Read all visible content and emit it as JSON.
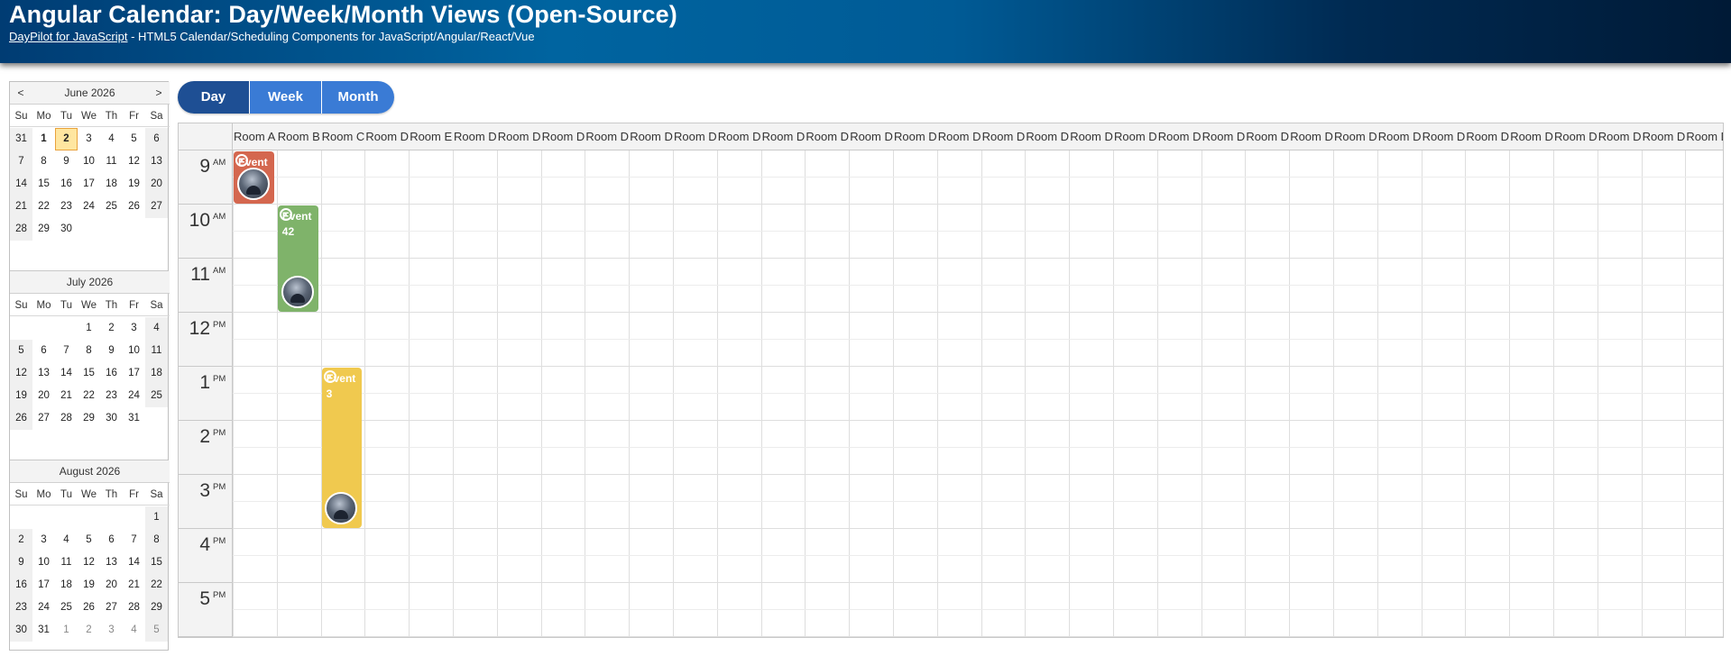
{
  "header": {
    "title": "Angular Calendar: Day/Week/Month Views (Open-Source)",
    "link": "DayPilot for JavaScript",
    "subtitle_rest": " - HTML5 Calendar/Scheduling Components for JavaScript/Angular/React/Vue"
  },
  "navigator": {
    "prev": "<",
    "next": ">",
    "dow": [
      "Su",
      "Mo",
      "Tu",
      "We",
      "Th",
      "Fr",
      "Sa"
    ],
    "months": [
      {
        "title": "June 2026",
        "weeks": [
          [
            "31",
            "1",
            "2",
            "3",
            "4",
            "5",
            "6"
          ],
          [
            "7",
            "8",
            "9",
            "10",
            "11",
            "12",
            "13"
          ],
          [
            "14",
            "15",
            "16",
            "17",
            "18",
            "19",
            "20"
          ],
          [
            "21",
            "22",
            "23",
            "24",
            "25",
            "26",
            "27"
          ],
          [
            "28",
            "29",
            "30",
            "",
            "",
            "",
            ""
          ]
        ]
      },
      {
        "title": "July 2026",
        "weeks": [
          [
            "",
            "",
            "",
            "1",
            "2",
            "3",
            "4"
          ],
          [
            "5",
            "6",
            "7",
            "8",
            "9",
            "10",
            "11"
          ],
          [
            "12",
            "13",
            "14",
            "15",
            "16",
            "17",
            "18"
          ],
          [
            "19",
            "20",
            "21",
            "22",
            "23",
            "24",
            "25"
          ],
          [
            "26",
            "27",
            "28",
            "29",
            "30",
            "31",
            ""
          ]
        ]
      },
      {
        "title": "August 2026",
        "weeks": [
          [
            "",
            "",
            "",
            "",
            "",
            "",
            "1"
          ],
          [
            "2",
            "3",
            "4",
            "5",
            "6",
            "7",
            "8"
          ],
          [
            "9",
            "10",
            "11",
            "12",
            "13",
            "14",
            "15"
          ],
          [
            "16",
            "17",
            "18",
            "19",
            "20",
            "21",
            "22"
          ],
          [
            "23",
            "24",
            "25",
            "26",
            "27",
            "28",
            "29"
          ],
          [
            "30",
            "31",
            "1",
            "2",
            "3",
            "4",
            "5"
          ]
        ]
      }
    ]
  },
  "views": {
    "day": "Day",
    "week": "Week",
    "month": "Month",
    "active": "day"
  },
  "calendar": {
    "columns": [
      "Room A",
      "Room B",
      "Room C",
      "Room D",
      "Room E",
      "Room D",
      "Room D",
      "Room D",
      "Room D",
      "Room D",
      "Room D",
      "Room D",
      "Room D",
      "Room D",
      "Room D",
      "Room D",
      "Room D",
      "Room D",
      "Room D",
      "Room D",
      "Room D",
      "Room D",
      "Room D",
      "Room D",
      "Room D",
      "Room D",
      "Room D",
      "Room D",
      "Room D",
      "Room D",
      "Room D",
      "Room D",
      "Room D",
      "Room D"
    ],
    "hours": [
      {
        "num": "9",
        "ampm": "AM"
      },
      {
        "num": "10",
        "ampm": "AM"
      },
      {
        "num": "11",
        "ampm": "AM"
      },
      {
        "num": "12",
        "ampm": "PM"
      },
      {
        "num": "1",
        "ampm": "PM"
      },
      {
        "num": "2",
        "ampm": "PM"
      },
      {
        "num": "3",
        "ampm": "PM"
      },
      {
        "num": "4",
        "ampm": "PM"
      },
      {
        "num": "5",
        "ampm": "PM"
      }
    ],
    "events": [
      {
        "text": "Event",
        "column": "Room A",
        "color": "#d4674f"
      },
      {
        "text": "Event 42",
        "column": "Room B",
        "color": "#7fb36a"
      },
      {
        "text": "Event 3",
        "column": "Room C",
        "color": "#f0c94f"
      }
    ]
  }
}
